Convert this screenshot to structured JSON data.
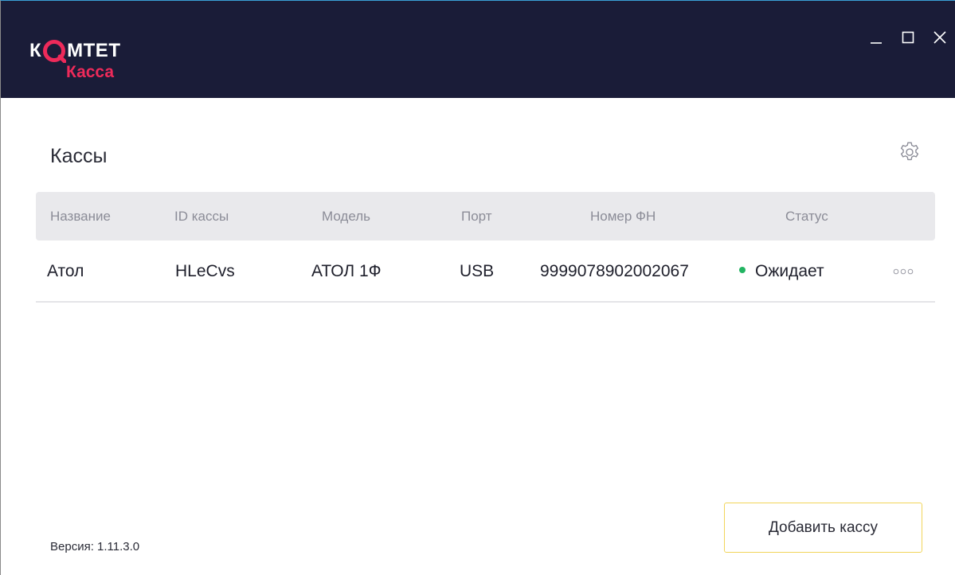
{
  "app": {
    "logo": {
      "k": "К",
      "rest": "МТЕТ",
      "sub": "Касса",
      "accent_color": "#ee2a5a",
      "bar_color": "#1a1c38"
    }
  },
  "window_controls": {
    "minimize_icon": "minimize-icon",
    "maximize_icon": "maximize-icon",
    "close_icon": "close-icon"
  },
  "page": {
    "title": "Кассы",
    "settings_icon": "gear-icon"
  },
  "table": {
    "headers": {
      "name": "Название",
      "id": "ID кассы",
      "model": "Модель",
      "port": "Порт",
      "fn": "Номер ФН",
      "status": "Статус"
    },
    "rows": [
      {
        "name": "Атол",
        "id": "HLeCvs",
        "model": "АТОЛ 1Ф",
        "port": "USB",
        "fn": "9999078902002067",
        "status": "Ожидает",
        "status_color": "#22b462",
        "menu_icon": "more-options-icon"
      }
    ]
  },
  "actions": {
    "add_label": "Добавить кассу",
    "add_border_color": "#f2d55a"
  },
  "footer": {
    "version_label": "Версия:",
    "version_value": "1.11.3.0"
  }
}
